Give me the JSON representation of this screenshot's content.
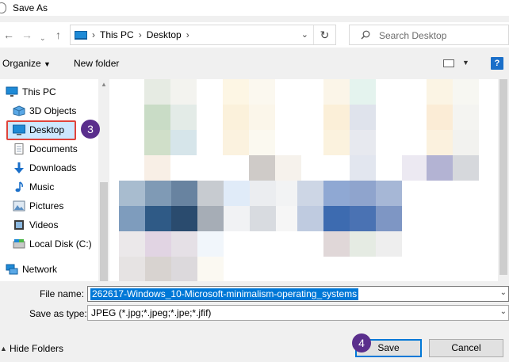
{
  "window": {
    "title": "Save As"
  },
  "nav": {
    "back_icon": "arrow-left-icon",
    "forward_icon": "arrow-right-icon",
    "recent_icon": "chevron-down-icon",
    "up_icon": "arrow-up-icon",
    "breadcrumb": [
      "This PC",
      "Desktop"
    ],
    "search_placeholder": "Search Desktop"
  },
  "toolbar": {
    "organize": "Organize",
    "new_folder": "New folder",
    "help": "?"
  },
  "sidebar": {
    "items": [
      {
        "label": "This PC",
        "icon": "computer-icon"
      },
      {
        "label": "3D Objects",
        "icon": "cube-icon"
      },
      {
        "label": "Desktop",
        "icon": "desktop-icon",
        "selected": true
      },
      {
        "label": "Documents",
        "icon": "documents-icon"
      },
      {
        "label": "Downloads",
        "icon": "download-icon"
      },
      {
        "label": "Music",
        "icon": "music-icon"
      },
      {
        "label": "Pictures",
        "icon": "pictures-icon"
      },
      {
        "label": "Videos",
        "icon": "video-icon"
      },
      {
        "label": "Local Disk (C:)",
        "icon": "disk-icon"
      },
      {
        "label": "Network",
        "icon": "network-icon"
      }
    ]
  },
  "callouts": {
    "step3": "3",
    "step4": "4"
  },
  "form": {
    "file_name_label": "File name:",
    "file_name_value": "262617-Windows_10-Microsoft-minimalism-operating_systems",
    "save_as_type_label": "Save as type:",
    "save_as_type_value": "JPEG (*.jpg;*.jpeg;*.jpe;*.jfif)"
  },
  "footer": {
    "hide_folders": "Hide Folders",
    "save": "Save",
    "cancel": "Cancel"
  },
  "colors": {
    "accent": "#0078d7",
    "callout": "#5a2e8c",
    "highlight_border": "#e0443c"
  }
}
